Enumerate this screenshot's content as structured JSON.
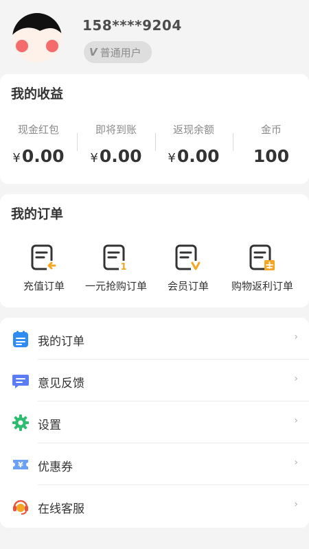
{
  "user": {
    "phone": "158****9204",
    "badge_label": "普通用户"
  },
  "earnings": {
    "title": "我的收益",
    "items": [
      {
        "label": "现金红包",
        "currency": "¥",
        "value": "0.00"
      },
      {
        "label": "即将到账",
        "currency": "¥",
        "value": "0.00"
      },
      {
        "label": "返现余额",
        "currency": "¥",
        "value": "0.00"
      },
      {
        "label": "金币",
        "currency": "",
        "value": "100"
      }
    ]
  },
  "orders": {
    "title": "我的订单",
    "items": [
      {
        "label": "充值订单",
        "icon": "recharge-order-icon"
      },
      {
        "label": "一元抢购订单",
        "icon": "flash-sale-order-icon"
      },
      {
        "label": "会员订单",
        "icon": "vip-order-icon"
      },
      {
        "label": "购物返利订单",
        "icon": "rebate-order-icon"
      }
    ]
  },
  "menu": {
    "arrow": "›",
    "items": [
      {
        "label": "我的订单",
        "icon": "order-list-icon"
      },
      {
        "label": "意见反馈",
        "icon": "feedback-icon"
      },
      {
        "label": "设置",
        "icon": "gear-icon"
      },
      {
        "label": "优惠券",
        "icon": "coupon-icon"
      },
      {
        "label": "在线客服",
        "icon": "customer-service-icon"
      }
    ]
  },
  "colors": {
    "background": "#f4f4f4",
    "accent_orange": "#f5a623",
    "menu_blue": "#2f8cf2",
    "menu_green": "#2ebd6f",
    "menu_red": "#e8553c"
  }
}
